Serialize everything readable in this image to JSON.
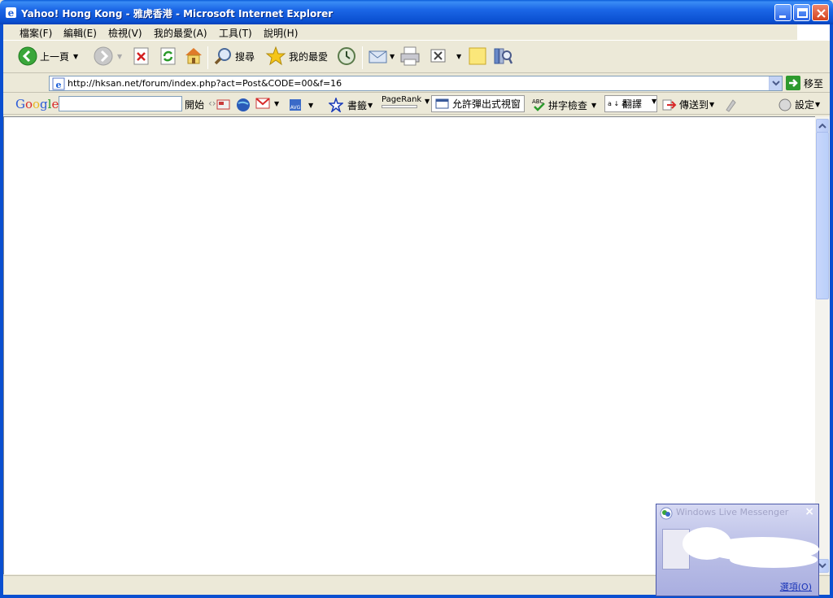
{
  "window": {
    "title": "Yahoo! Hong Kong - 雅虎香港 - Microsoft Internet Explorer"
  },
  "menu": [
    "檔案(F)",
    "編輯(E)",
    "檢視(V)",
    "我的最愛(A)",
    "工具(T)",
    "說明(H)"
  ],
  "toolbar": {
    "back": "上一頁",
    "search": "搜尋",
    "favorites": "我的最愛"
  },
  "address": {
    "url": "http://hksan.net/forum/index.php?act=Post&CODE=00&f=16",
    "go": "移至"
  },
  "google": {
    "logo": "Google",
    "start": "開始",
    "bookmarks": "書籤",
    "pagerank": "PageRank",
    "popup": "允許彈出式視窗",
    "spellcheck": "拼字檢查",
    "translate_glyph": "a ↓ あ",
    "translate": "翻譯",
    "sendto": "傳送到",
    "settings": "設定"
  },
  "messenger": {
    "title": "Windows Live Messenger",
    "options": "選項(O)"
  }
}
